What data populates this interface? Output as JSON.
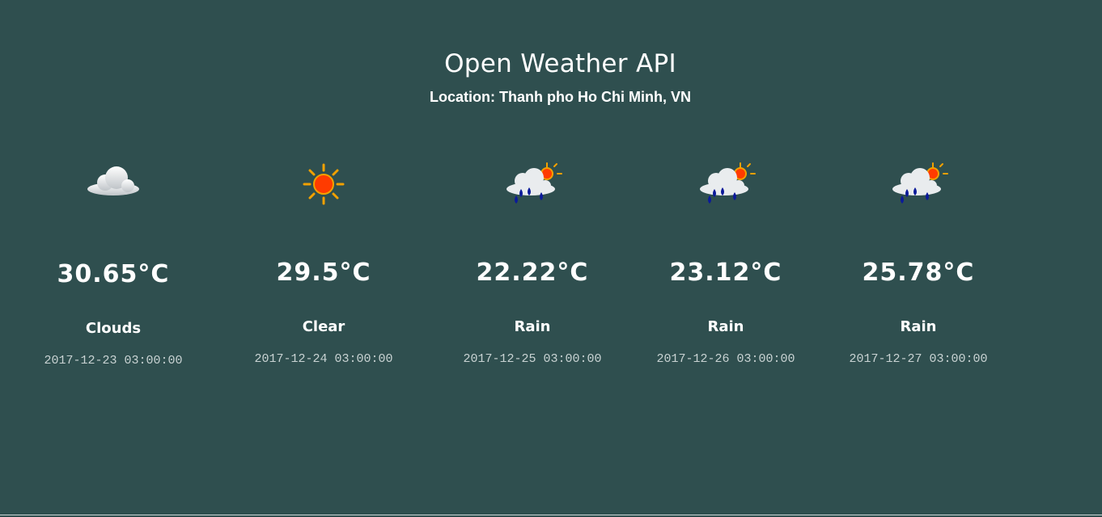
{
  "page": {
    "title": "Open Weather API",
    "location_label": "Location:",
    "location_value": "Thanh pho Ho Chi Minh, VN"
  },
  "forecast": [
    {
      "icon": "cloud-icon",
      "temp": "30.65°C",
      "condition": "Clouds",
      "date": "2017-12-23 03:00:00"
    },
    {
      "icon": "sun-icon",
      "temp": "29.5°C",
      "condition": "Clear",
      "date": "2017-12-24 03:00:00"
    },
    {
      "icon": "rain-sun-icon",
      "temp": "22.22°C",
      "condition": "Rain",
      "date": "2017-12-25 03:00:00"
    },
    {
      "icon": "rain-sun-icon",
      "temp": "23.12°C",
      "condition": "Rain",
      "date": "2017-12-26 03:00:00"
    },
    {
      "icon": "rain-sun-icon",
      "temp": "25.78°C",
      "condition": "Rain",
      "date": "2017-12-27 03:00:00"
    }
  ],
  "colors": {
    "background": "#2f4f4f",
    "text": "#ffffff",
    "date_text": "#c9d3d3",
    "sun": "#ff3b00",
    "sun_rays": "#f2a100",
    "rain": "#0b1a9a"
  }
}
